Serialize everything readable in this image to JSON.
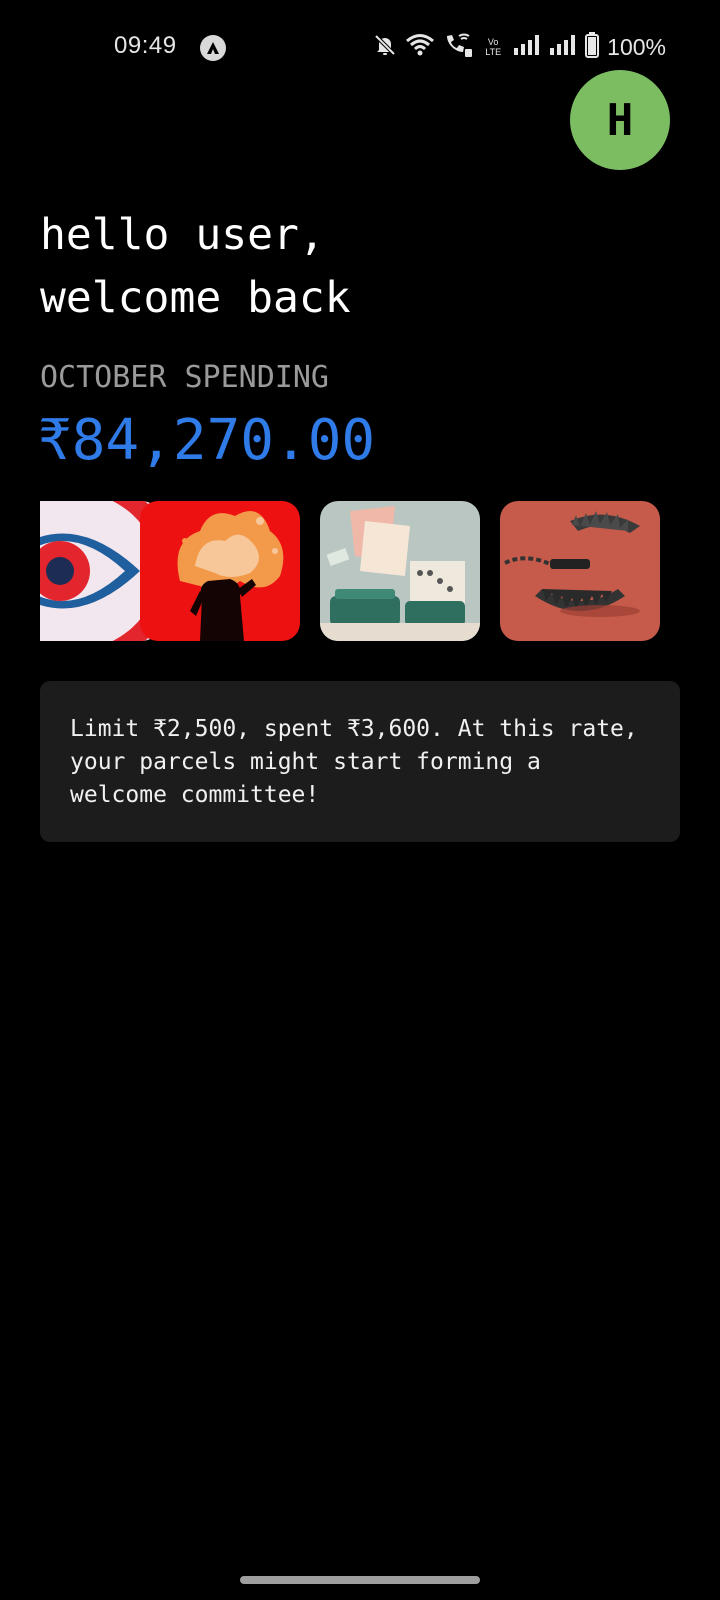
{
  "status_bar": {
    "time": "09:49",
    "volte_line1": "Vo",
    "volte_line2": "LTE",
    "battery_text": "100%",
    "icons": [
      "app-notification-icon",
      "mute-bell-icon",
      "wifi-icon",
      "wifi-calling-icon",
      "volte-icon",
      "signal-icon",
      "signal-icon",
      "battery-icon"
    ]
  },
  "avatar": {
    "initial": "H",
    "color": "#7dbd62"
  },
  "greeting": {
    "line1": "hello user,",
    "line2": "welcome back"
  },
  "spending": {
    "label": "OCTOBER SPENDING",
    "amount": "₹84,270.00",
    "amount_color": "#2f7be8"
  },
  "carousel": {
    "cards": [
      {
        "icon": "eye-illustration-icon"
      },
      {
        "icon": "burning-figure-illustration-icon"
      },
      {
        "icon": "typewriter-receipts-illustration-icon"
      },
      {
        "icon": "bear-trap-illustration-icon"
      }
    ]
  },
  "message": {
    "text": "Limit ₹2,500, spent ₹3,600. At this rate, your parcels might start forming a welcome committee!"
  }
}
